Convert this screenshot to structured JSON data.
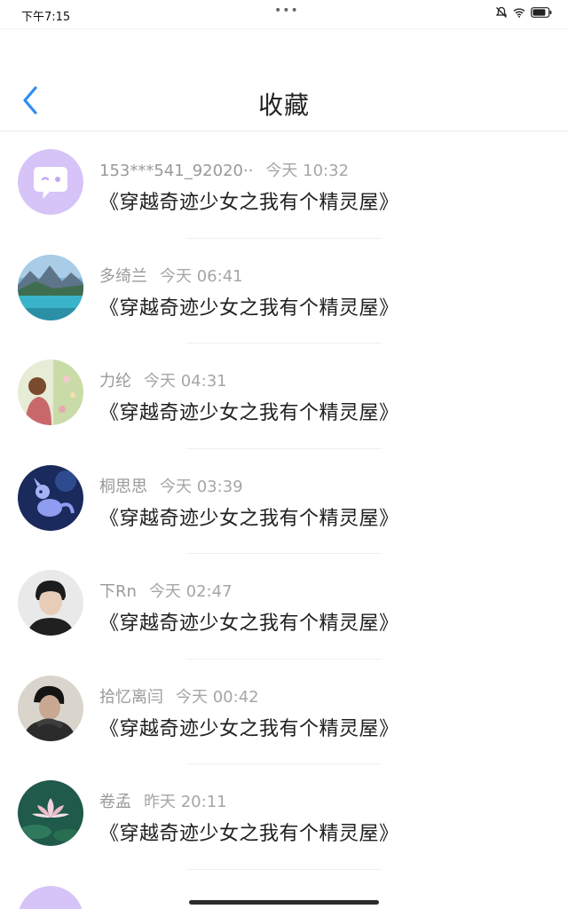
{
  "status_bar": {
    "time": "下午7:15",
    "dots": "•••",
    "icons": [
      "mute-icon",
      "wifi-icon",
      "battery-icon"
    ]
  },
  "nav": {
    "title": "收藏",
    "back_icon": "chevron-left-icon"
  },
  "colors": {
    "accent": "#2f8cf5",
    "placeholder_avatar": "#d6c3f7"
  },
  "items": [
    {
      "user": "153***541_92020··",
      "time": "今天 10:32",
      "title": "《穿越奇迹少女之我有个精灵屋》",
      "avatar": "chat-bubble-avatar"
    },
    {
      "user": "多绮兰",
      "time": "今天 06:41",
      "title": "《穿越奇迹少女之我有个精灵屋》",
      "avatar": "lake-mountain-avatar"
    },
    {
      "user": "力纶",
      "time": "今天 04:31",
      "title": "《穿越奇迹少女之我有个精灵屋》",
      "avatar": "girl-flowers-avatar"
    },
    {
      "user": "桐思思",
      "time": "今天 03:39",
      "title": "《穿越奇迹少女之我有个精灵屋》",
      "avatar": "night-creature-avatar"
    },
    {
      "user": "下Rn",
      "time": "今天 02:47",
      "title": "《穿越奇迹少女之我有个精灵屋》",
      "avatar": "boy-portrait-avatar"
    },
    {
      "user": "拾忆离闫",
      "time": "今天 00:42",
      "title": "《穿越奇迹少女之我有个精灵屋》",
      "avatar": "man-portrait-avatar"
    },
    {
      "user": "卷孟",
      "time": "昨天 20:11",
      "title": "《穿越奇迹少女之我有个精灵屋》",
      "avatar": "lotus-avatar"
    }
  ]
}
